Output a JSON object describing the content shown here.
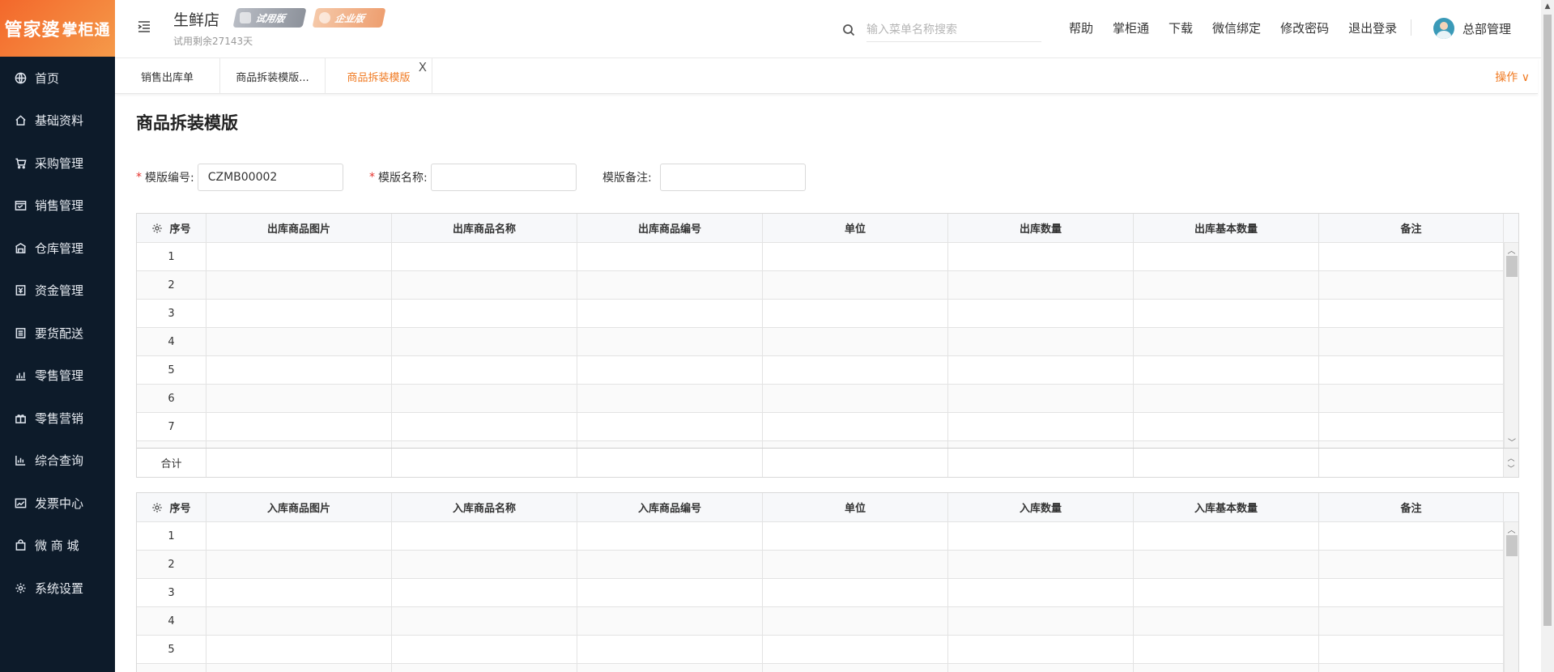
{
  "logo": {
    "part1": "管家婆",
    "part2": "掌柜通"
  },
  "sidebar": {
    "items": [
      {
        "label": "首页",
        "icon": "globe-icon"
      },
      {
        "label": "基础资料",
        "icon": "home-icon"
      },
      {
        "label": "采购管理",
        "icon": "cart-icon"
      },
      {
        "label": "销售管理",
        "icon": "sales-icon"
      },
      {
        "label": "仓库管理",
        "icon": "warehouse-icon"
      },
      {
        "label": "资金管理",
        "icon": "money-icon"
      },
      {
        "label": "要货配送",
        "icon": "list-icon"
      },
      {
        "label": "零售管理",
        "icon": "bar-chart-icon"
      },
      {
        "label": "零售营销",
        "icon": "gift-icon"
      },
      {
        "label": "综合查询",
        "icon": "chart-icon"
      },
      {
        "label": "发票中心",
        "icon": "line-chart-icon"
      },
      {
        "label": "微 商 城",
        "icon": "bag-icon"
      },
      {
        "label": "系统设置",
        "icon": "gear-icon"
      }
    ]
  },
  "header": {
    "store_name": "生鲜店",
    "trial_remaining": "试用剩余27143天",
    "badge_trial": "试用版",
    "badge_enterprise": "企业版",
    "search_placeholder": "输入菜单名称搜索",
    "links": [
      "帮助",
      "掌柜通",
      "下载",
      "微信绑定",
      "修改密码",
      "退出登录"
    ],
    "user_name": "总部管理"
  },
  "tabs": {
    "items": [
      "销售出库单",
      "商品拆装模版...",
      "商品拆装模版"
    ],
    "close": "X",
    "ops_label": "操作 ∨"
  },
  "page": {
    "title": "商品拆装模版",
    "form": {
      "code_label": "模版编号:",
      "code_value": "CZMB00002",
      "name_label": "模版名称:",
      "name_value": "",
      "note_label": "模版备注:",
      "note_value": ""
    }
  },
  "out_table": {
    "headers": [
      "序号",
      "出库商品图片",
      "出库商品名称",
      "出库商品编号",
      "单位",
      "出库数量",
      "出库基本数量",
      "备注"
    ],
    "rows": [
      "1",
      "2",
      "3",
      "4",
      "5",
      "6",
      "7"
    ],
    "total_label": "合计"
  },
  "in_table": {
    "headers": [
      "序号",
      "入库商品图片",
      "入库商品名称",
      "入库商品编号",
      "单位",
      "入库数量",
      "入库基本数量",
      "备注"
    ],
    "rows": [
      "1",
      "2",
      "3",
      "4",
      "5"
    ]
  },
  "colors": {
    "accent": "#f07a22",
    "sidebar_bg": "#0d1b2a",
    "required": "#e5322d"
  }
}
